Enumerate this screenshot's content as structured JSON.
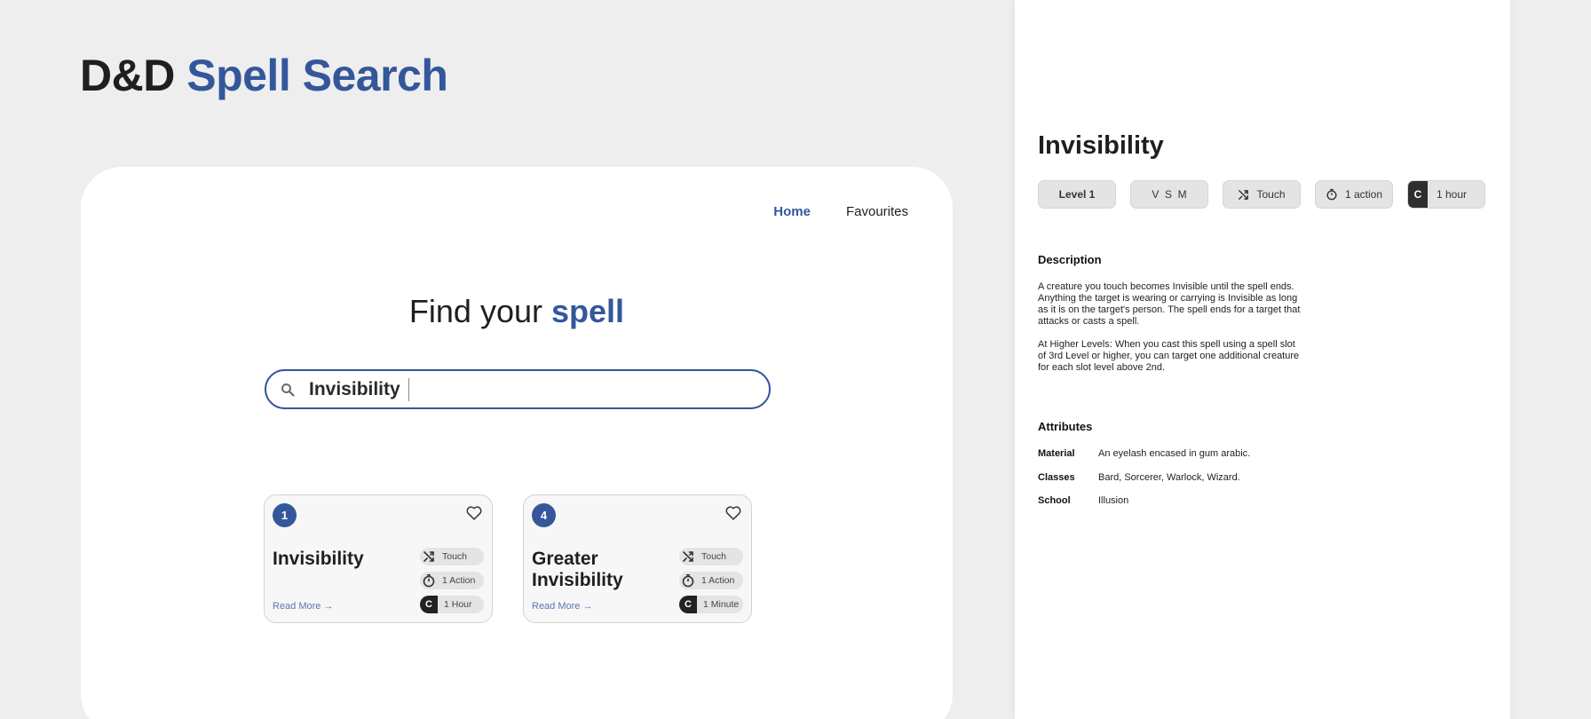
{
  "app_title": {
    "part1": "D&D",
    "part2": "Spell Search"
  },
  "nav": {
    "home": "Home",
    "favourites": "Favourites"
  },
  "hero": {
    "text": "Find your",
    "highlight": "spell"
  },
  "search": {
    "value": "Invisibility",
    "icon": "search-icon"
  },
  "results": [
    {
      "level": "1",
      "name": "Invisibility",
      "read_more": "Read More →",
      "range": "Touch",
      "casting_time": "1 Action",
      "concentration_badge": "C",
      "duration": "1 Hour"
    },
    {
      "level": "4",
      "name": "Greater Invisibility",
      "read_more": "Read More →",
      "range": "Touch",
      "casting_time": "1 Action",
      "concentration_badge": "C",
      "duration": "1 Minute"
    }
  ],
  "detail": {
    "title": "Invisibility",
    "tags": {
      "level": "Level 1",
      "components": "V  S  M",
      "range": "Touch",
      "casting_time": "1 action",
      "concentration_badge": "C",
      "duration": "1 hour"
    },
    "description_heading": "Description",
    "description": [
      "A creature you touch becomes Invisible until the spell ends. Anything the target is wearing or carrying is Invisible as long as it is on the target's person. The spell ends for a target that attacks or casts a spell.",
      "At Higher Levels: When you cast this spell using a spell slot of 3rd Level or higher, you can target one additional creature for each slot level above 2nd."
    ],
    "attributes_heading": "Attributes",
    "attributes": [
      {
        "key": "Material",
        "value": "An eyelash encased in gum arabic."
      },
      {
        "key": "Classes",
        "value": "Bard, Sorcerer, Warlock, Wizard."
      },
      {
        "key": "School",
        "value": "Illusion"
      }
    ]
  },
  "colors": {
    "accent": "#34579c",
    "background": "#eeeeee",
    "panel": "#ffffff",
    "pill": "#e4e4e4"
  }
}
